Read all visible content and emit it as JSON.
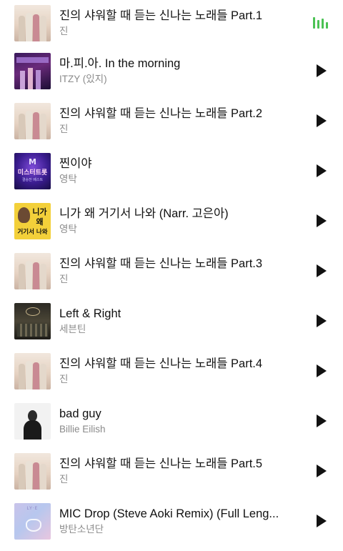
{
  "tracks": [
    {
      "title": "진의 샤워할 때 듣는 신나는 노래들 Part.1",
      "artist": "진",
      "art": "jin-album-art",
      "state": "playing"
    },
    {
      "title": "마.피.아. In the morning",
      "artist": "ITZY (있지)",
      "art": "itzy-album-art",
      "state": "play"
    },
    {
      "title": "진의 샤워할 때 듣는 신나는 노래들 Part.2",
      "artist": "진",
      "art": "jin-album-art",
      "state": "play"
    },
    {
      "title": "찐이야",
      "artist": "영탁",
      "art": "mister-trot-album-art",
      "state": "play"
    },
    {
      "title": "니가 왜 거기서 나와 (Narr. 고은아)",
      "artist": "영탁",
      "art": "nida-album-art",
      "state": "play"
    },
    {
      "title": "진의 샤워할 때 듣는 신나는 노래들 Part.3",
      "artist": "진",
      "art": "jin-album-art",
      "state": "play"
    },
    {
      "title": "Left & Right",
      "artist": "세븐틴",
      "art": "seventeen-album-art",
      "state": "play"
    },
    {
      "title": "진의 샤워할 때 듣는 신나는 노래들 Part.4",
      "artist": "진",
      "art": "jin-album-art",
      "state": "play"
    },
    {
      "title": "bad guy",
      "artist": "Billie Eilish",
      "art": "billie-album-art",
      "state": "play"
    },
    {
      "title": "진의 샤워할 때 듣는 신나는 노래들 Part.5",
      "artist": "진",
      "art": "jin-album-art",
      "state": "play"
    },
    {
      "title": "MIC Drop (Steve Aoki Remix) (Full Leng...",
      "artist": "방탄소년단",
      "art": "bts-album-art",
      "state": "play"
    }
  ],
  "art_text": {
    "mister_trot_big": "미스터트롯",
    "mister_trot_small": "결승전 베스트",
    "nida_line1": "니가",
    "nida_line2": "왜",
    "nida_line3": "거기서 나와",
    "bts_top": "LY·E"
  },
  "colors": {
    "accent_green": "#4bc254",
    "subtext": "#8a8a8a"
  }
}
